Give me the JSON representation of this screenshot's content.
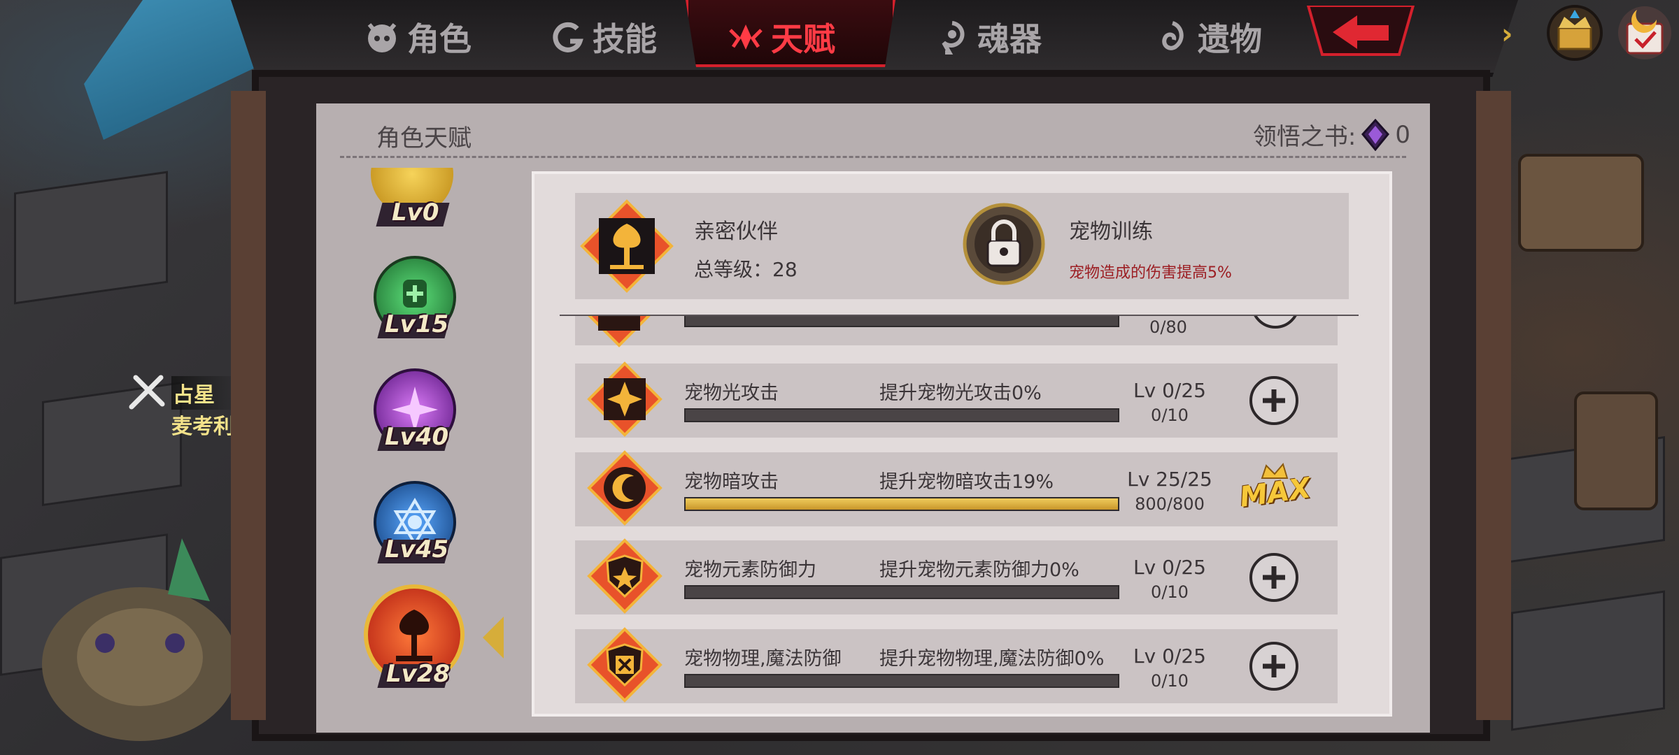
{
  "tabs": [
    {
      "label": "角色",
      "icon": "demon-face-icon",
      "active": false
    },
    {
      "label": "技能",
      "icon": "swirl-icon",
      "active": false
    },
    {
      "label": "天赋",
      "icon": "talent-wings-icon",
      "active": true
    },
    {
      "label": "魂器",
      "icon": "soul-gem-icon",
      "active": false
    },
    {
      "label": "遗物",
      "icon": "relic-swirl-icon",
      "active": false
    }
  ],
  "character": {
    "role": "占星",
    "name": "麦考利"
  },
  "panel": {
    "title": "角色天赋",
    "book_label": "领悟之书:",
    "book_count": "0"
  },
  "talent_list": [
    {
      "level": "Lv0",
      "color": "#e2b52a",
      "icon": "golden-emblem-icon"
    },
    {
      "level": "Lv15",
      "color": "#3cc35a",
      "icon": "green-skull-icon"
    },
    {
      "level": "Lv40",
      "color": "#b13be0",
      "icon": "purple-star-icon"
    },
    {
      "level": "Lv45",
      "color": "#2f7fe0",
      "icon": "blue-hexagram-icon"
    },
    {
      "level": "Lv28",
      "color": "#e8522a",
      "icon": "pet-tree-icon",
      "selected": true
    }
  ],
  "detail": {
    "name": "亲密伙伴",
    "total_level": "总等级：28",
    "skill_name": "宠物训练",
    "skill_desc": "宠物造成的伤害提高5%",
    "skill_locked": true
  },
  "rows": [
    {
      "name": "",
      "desc": "",
      "level": "",
      "count": "0/80",
      "progress": 0,
      "action": "plus",
      "partial": true,
      "icon": "pet-tree-icon"
    },
    {
      "name": "宠物光攻击",
      "desc": "提升宠物光攻击0%",
      "level": "Lv 0/25",
      "count": "0/10",
      "progress": 0,
      "action": "plus",
      "icon": "light-star-icon"
    },
    {
      "name": "宠物暗攻击",
      "desc": "提升宠物暗攻击19%",
      "level": "Lv 25/25",
      "count": "800/800",
      "progress": 1,
      "action": "max",
      "icon": "dark-moon-icon"
    },
    {
      "name": "宠物元素防御力",
      "desc": "提升宠物元素防御力0%",
      "level": "Lv 0/25",
      "count": "0/10",
      "progress": 0,
      "action": "plus",
      "icon": "element-shield-icon"
    },
    {
      "name": "宠物物理,魔法防御",
      "desc": "提升宠物物理,魔法防御0%",
      "level": "Lv 0/25",
      "count": "0/10",
      "progress": 0,
      "action": "plus",
      "icon": "cross-shield-icon"
    }
  ],
  "max_label": "MAX"
}
